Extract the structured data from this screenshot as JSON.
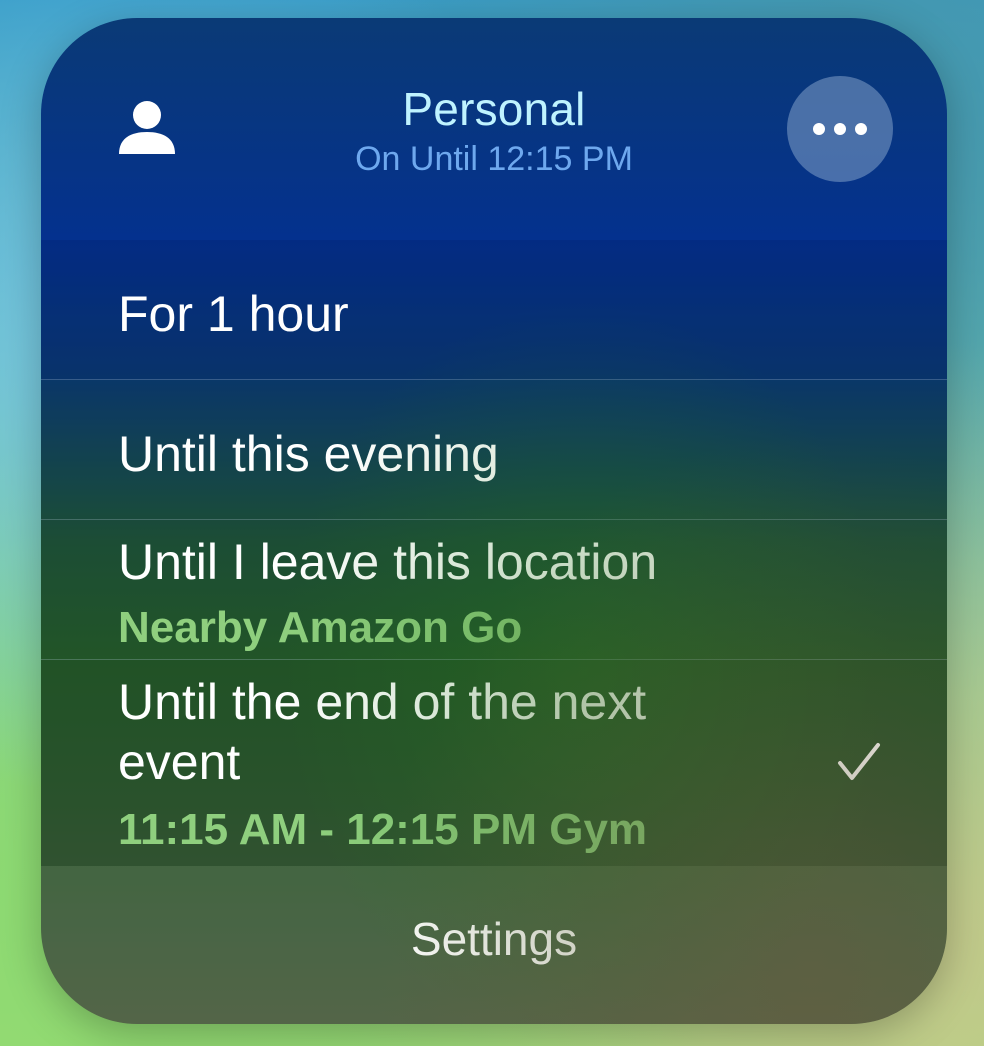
{
  "header": {
    "title": "Personal",
    "subtitle": "On Until 12:15 PM",
    "leading_icon": "person-icon",
    "more_icon": "ellipsis-icon"
  },
  "options": [
    {
      "label": "For 1 hour"
    },
    {
      "label": "Until this evening"
    },
    {
      "label": "Until I leave this location",
      "detail": "Nearby Amazon Go"
    },
    {
      "label": "Until the end of the next event",
      "detail": "11:15 AM - 12:15 PM Gym",
      "selected": true
    }
  ],
  "selected_icon": "checkmark-icon",
  "footer": {
    "settings_label": "Settings"
  },
  "colors": {
    "title": "#bff3ff",
    "subtitle": "#6ea8ee",
    "detail": "#8fcf7e",
    "text": "#ffffff"
  }
}
